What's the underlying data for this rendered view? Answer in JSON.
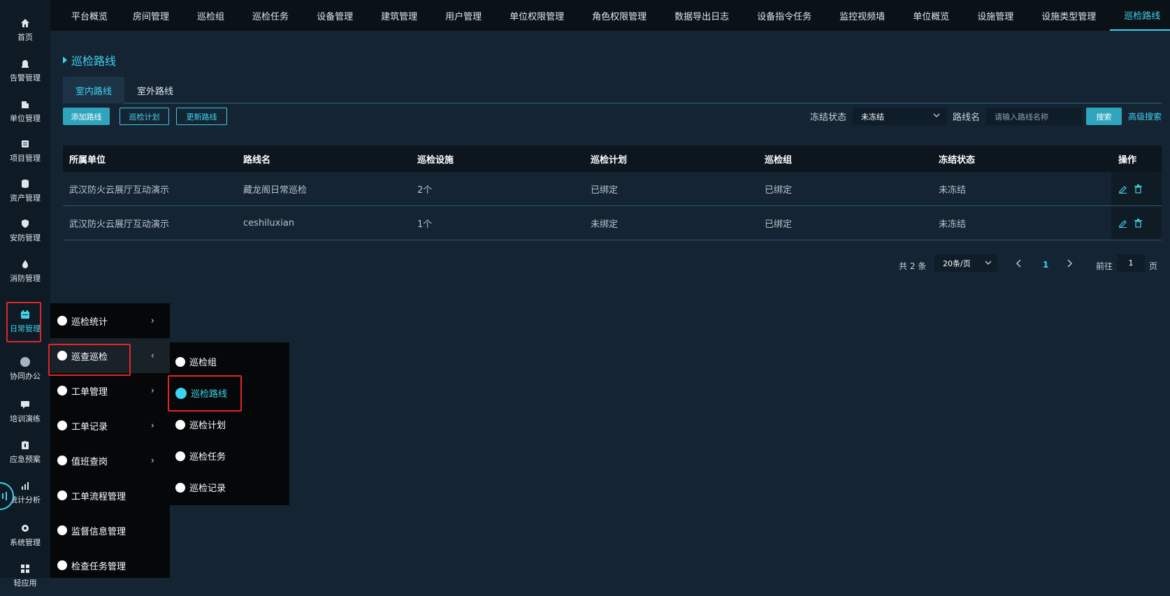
{
  "sidebar": {
    "items": [
      {
        "label": "首页",
        "icon": "home-icon"
      },
      {
        "label": "告警管理",
        "icon": "alarm-icon"
      },
      {
        "label": "单位管理",
        "icon": "building-icon"
      },
      {
        "label": "项目管理",
        "icon": "folder-icon"
      },
      {
        "label": "资产管理",
        "icon": "database-icon"
      },
      {
        "label": "安防管理",
        "icon": "shield-icon"
      },
      {
        "label": "消防管理",
        "icon": "fire-icon"
      },
      {
        "label": "日常管理",
        "icon": "calendar-icon"
      },
      {
        "label": "协同办公",
        "icon": "circle-icon"
      },
      {
        "label": "培训演练",
        "icon": "chat-icon"
      },
      {
        "label": "应急预案",
        "icon": "clipboard-icon"
      },
      {
        "label": "统计分析",
        "icon": "chart-icon"
      },
      {
        "label": "系统管理",
        "icon": "settings-icon"
      },
      {
        "label": "轻应用",
        "icon": "apps-icon"
      }
    ]
  },
  "tabs": [
    "平台概览",
    "房间管理",
    "巡检组",
    "巡检任务",
    "设备管理",
    "建筑管理",
    "用户管理",
    "单位权限管理",
    "角色权限管理",
    "数据导出日志",
    "设备指令任务",
    "监控视频墙",
    "单位概览",
    "设施管理",
    "设施类型管理",
    "巡检路线"
  ],
  "page": {
    "title": "巡检路线",
    "subtabs": [
      "室内路线",
      "室外路线"
    ]
  },
  "toolbar": {
    "add": "添加路线",
    "plan": "巡检计划",
    "update": "更新路线"
  },
  "filters": {
    "freeze_label": "冻结状态",
    "freeze_value": "未冻结",
    "route_label": "路线名",
    "route_placeholder": "请输入路线名称",
    "search": "搜索",
    "advanced": "高级搜索"
  },
  "table": {
    "headers": [
      "所属单位",
      "路线名",
      "巡检设施",
      "巡检计划",
      "巡检组",
      "冻结状态",
      "操作"
    ],
    "rows": [
      [
        "武汉防火云展厅互动演示",
        "藏龙阁日常巡检",
        "2个",
        "已绑定",
        "已绑定",
        "未冻结"
      ],
      [
        "武汉防火云展厅互动演示",
        "ceshiluxian",
        "1个",
        "未绑定",
        "已绑定",
        "未冻结"
      ]
    ]
  },
  "pagination": {
    "total": "共 2 条",
    "page_size": "20条/页",
    "current": "1",
    "goto_label": "前往",
    "goto_value": "1",
    "page_suffix": "页"
  },
  "menu1": [
    "巡检统计",
    "巡查巡检",
    "工单管理",
    "工单记录",
    "值班查岗",
    "工单流程管理",
    "监督信息管理",
    "检查任务管理"
  ],
  "menu2": [
    "巡检组",
    "巡检路线",
    "巡检计划",
    "巡检任务",
    "巡检记录"
  ],
  "colors": {
    "accent": "#3fd3f0",
    "highlight": "#e0262b",
    "bg": "#142433"
  }
}
